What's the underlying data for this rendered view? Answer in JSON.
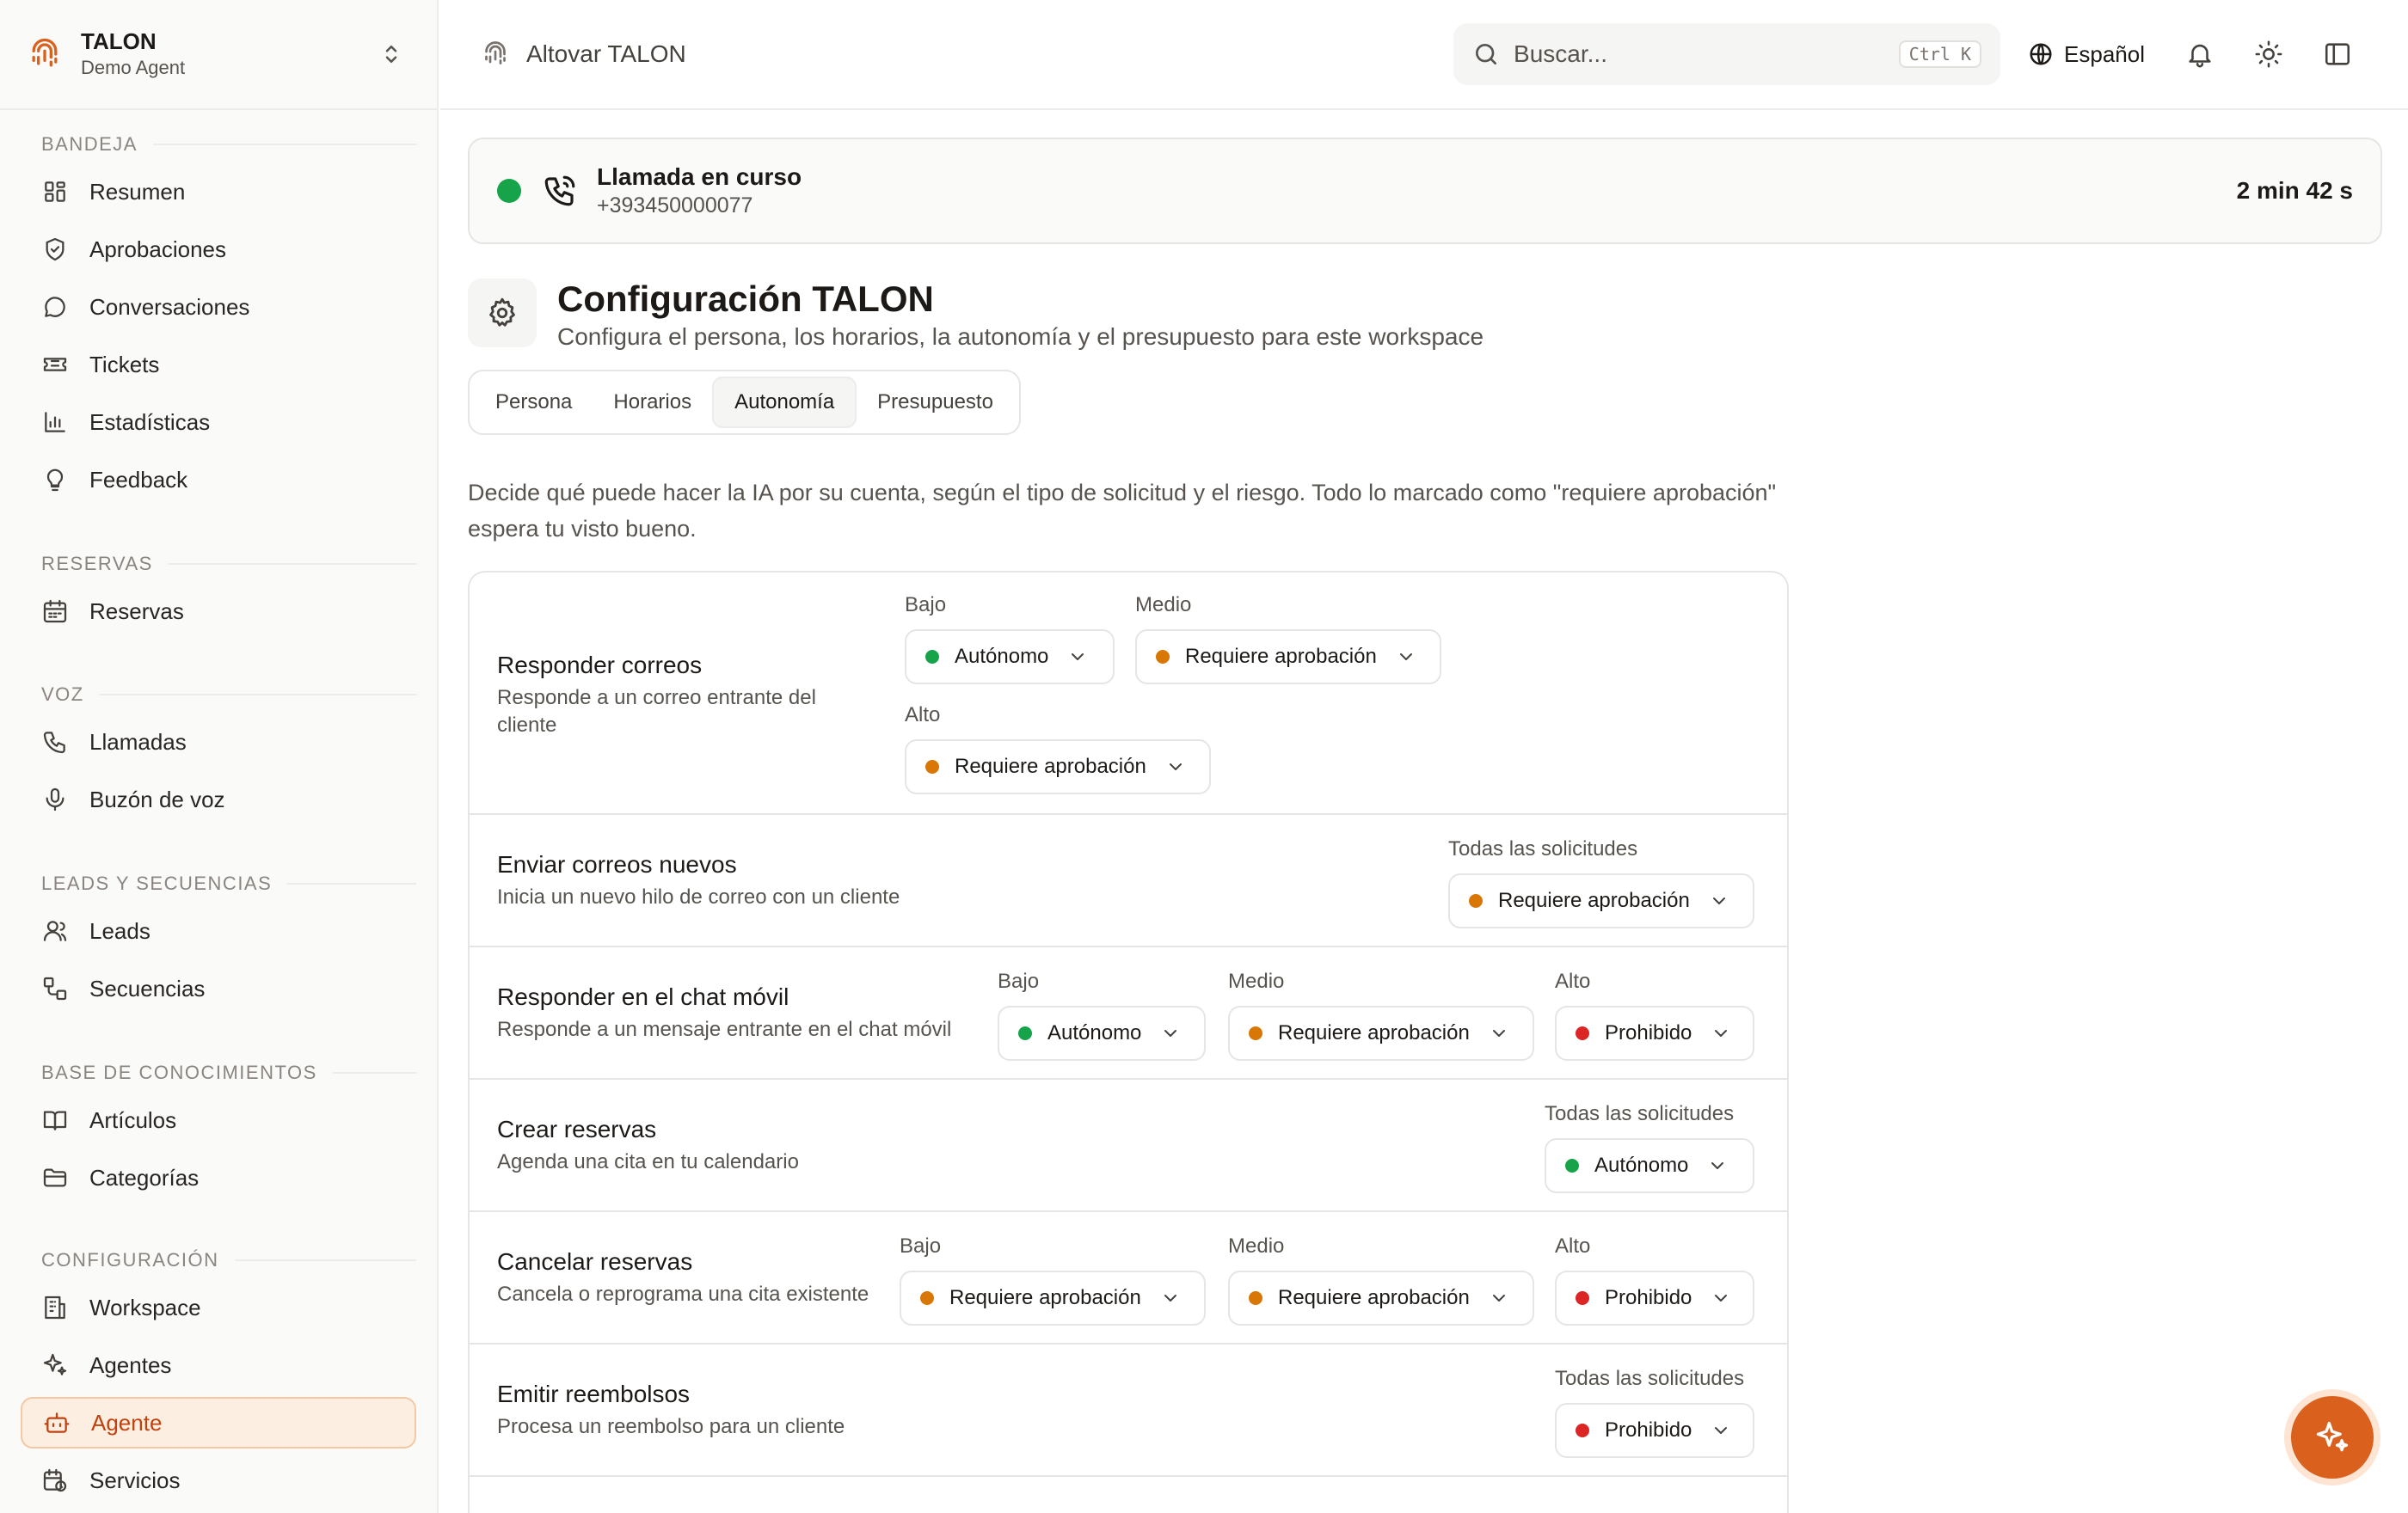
{
  "brand": {
    "name": "TALON",
    "sub": "Demo Agent"
  },
  "nav": {
    "sections": [
      {
        "title": "BANDEJA",
        "items": [
          {
            "label": "Resumen",
            "icon": "dashboard-icon"
          },
          {
            "label": "Aprobaciones",
            "icon": "shield-check-icon"
          },
          {
            "label": "Conversaciones",
            "icon": "chat-bubble-icon"
          },
          {
            "label": "Tickets",
            "icon": "ticket-icon"
          },
          {
            "label": "Estadísticas",
            "icon": "bar-chart-icon"
          },
          {
            "label": "Feedback",
            "icon": "lightbulb-icon"
          }
        ]
      },
      {
        "title": "RESERVAS",
        "items": [
          {
            "label": "Reservas",
            "icon": "calendar-icon"
          }
        ]
      },
      {
        "title": "VOZ",
        "items": [
          {
            "label": "Llamadas",
            "icon": "phone-icon"
          },
          {
            "label": "Buzón de voz",
            "icon": "microphone-icon"
          }
        ]
      },
      {
        "title": "LEADS Y SECUENCIAS",
        "items": [
          {
            "label": "Leads",
            "icon": "user-icon"
          },
          {
            "label": "Secuencias",
            "icon": "sequence-icon"
          }
        ]
      },
      {
        "title": "BASE DE CONOCIMIENTOS",
        "items": [
          {
            "label": "Artículos",
            "icon": "book-icon"
          },
          {
            "label": "Categorías",
            "icon": "folder-icon"
          }
        ]
      },
      {
        "title": "CONFIGURACIÓN",
        "items": [
          {
            "label": "Workspace",
            "icon": "building-icon"
          },
          {
            "label": "Agentes",
            "icon": "sparkles-icon"
          },
          {
            "label": "Agente",
            "icon": "bot-icon",
            "active": true
          },
          {
            "label": "Servicios",
            "icon": "calendar-clock-icon"
          }
        ]
      }
    ]
  },
  "topbar": {
    "app_title": "Altovar TALON",
    "search_placeholder": "Buscar...",
    "shortcut": "Ctrl K",
    "language": "Español"
  },
  "call": {
    "status": "Llamada en curso",
    "number": "+393450000077",
    "duration": "2 min 42 s"
  },
  "config": {
    "title": "Configuración TALON",
    "subtitle": "Configura el persona, los horarios, la autonomía y el presupuesto para este workspace",
    "tabs": [
      "Persona",
      "Horarios",
      "Autonomía",
      "Presupuesto"
    ],
    "active_tab": "Autonomía",
    "description": "Decide qué puede hacer la IA por su cuenta, según el tipo de solicitud y el riesgo. Todo lo marcado como \"requiere aprobación\" espera tu visto bueno."
  },
  "rules": [
    {
      "title": "Responder correos",
      "desc": "Responde a un correo entrante del cliente",
      "fields": [
        {
          "label": "Bajo",
          "value": "Autónomo",
          "status": "autonomous"
        },
        {
          "label": "Medio",
          "value": "Requiere aprobación",
          "status": "approval"
        },
        {
          "label": "Alto",
          "value": "Requiere aprobación",
          "status": "approval"
        }
      ]
    },
    {
      "title": "Enviar correos nuevos",
      "desc": "Inicia un nuevo hilo de correo con un cliente",
      "fields": [
        {
          "label": "Todas las solicitudes",
          "value": "Requiere aprobación",
          "status": "approval"
        }
      ]
    },
    {
      "title": "Responder en el chat móvil",
      "desc": "Responde a un mensaje entrante en el chat móvil",
      "fields": [
        {
          "label": "Bajo",
          "value": "Autónomo",
          "status": "autonomous"
        },
        {
          "label": "Medio",
          "value": "Requiere aprobación",
          "status": "approval"
        },
        {
          "label": "Alto",
          "value": "Prohibido",
          "status": "forbidden"
        }
      ]
    },
    {
      "title": "Crear reservas",
      "desc": "Agenda una cita en tu calendario",
      "fields": [
        {
          "label": "Todas las solicitudes",
          "value": "Autónomo",
          "status": "autonomous"
        }
      ]
    },
    {
      "title": "Cancelar reservas",
      "desc": "Cancela o reprograma una cita existente",
      "fields": [
        {
          "label": "Bajo",
          "value": "Requiere aprobación",
          "status": "approval"
        },
        {
          "label": "Medio",
          "value": "Requiere aprobación",
          "status": "approval"
        },
        {
          "label": "Alto",
          "value": "Prohibido",
          "status": "forbidden"
        }
      ]
    },
    {
      "title": "Emitir reembolsos",
      "desc": "Procesa un reembolso para un cliente",
      "fields": [
        {
          "label": "Todas las solicitudes",
          "value": "Prohibido",
          "status": "forbidden"
        }
      ]
    }
  ],
  "status_colors": {
    "autonomous": "#16a34a",
    "approval": "#d97706",
    "forbidden": "#dc2626",
    "accent": "#d9601d",
    "live": "#16a34a"
  }
}
